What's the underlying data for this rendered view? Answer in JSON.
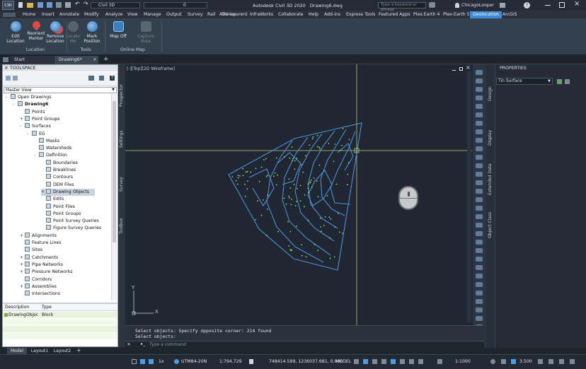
{
  "app": {
    "logo": "C3D",
    "workspace": "Civil 3D",
    "layer": "0",
    "title": "Autodesk Civil 3D 2020",
    "file": "Drawing6.dwg",
    "search_placeholder": "Type a keyword or phrase",
    "user": "ChicagoLooper"
  },
  "menu_tabs": [
    "Home",
    "Insert",
    "Annotate",
    "Modify",
    "Analyze",
    "View",
    "Manage",
    "Output",
    "Survey",
    "Rail",
    "Add-ins",
    "Transparent",
    "InfraWorks",
    "Collaborate",
    "Help",
    "Add-ins",
    "Express Tools",
    "Featured Apps",
    "Plex.Earth 4",
    "Plex-Earth 5",
    "Geolocation",
    "ArcGIS"
  ],
  "active_tab": "Geolocation",
  "ribbon": {
    "buttons": [
      {
        "label1": "Edit",
        "label2": "Location",
        "icon": "globe-edit-icon",
        "enabled": true
      },
      {
        "label1": "Reorient",
        "label2": "Marker",
        "icon": "marker-icon",
        "enabled": true
      },
      {
        "label1": "Remove",
        "label2": "Location",
        "icon": "globe-remove-icon",
        "enabled": true
      },
      {
        "label1": "Locate",
        "label2": "Me",
        "icon": "locate-me-icon",
        "enabled": false
      },
      {
        "label1": "Mark",
        "label2": "Position",
        "icon": "globe-mark-icon",
        "enabled": true
      },
      {
        "label1": "Map Off",
        "label2": "",
        "icon": "map-icon",
        "enabled": true
      },
      {
        "label1": "Capture",
        "label2": "Area",
        "icon": "capture-area-icon",
        "enabled": false
      }
    ],
    "panels": [
      "Location",
      "Tools",
      "Online Map"
    ]
  },
  "doc_tabs": [
    "Start",
    "Drawing6*"
  ],
  "toolspace": {
    "title": "TOOLSPACE",
    "view_select": "Master View",
    "tree": [
      {
        "label": "Open Drawings",
        "level": 0,
        "exp": "-"
      },
      {
        "label": "Drawing6",
        "level": 1,
        "exp": "-",
        "bold": true
      },
      {
        "label": "Points",
        "level": 2,
        "exp": ""
      },
      {
        "label": "Point Groups",
        "level": 2,
        "exp": "+"
      },
      {
        "label": "Surfaces",
        "level": 2,
        "exp": "-"
      },
      {
        "label": "EG",
        "level": 3,
        "exp": "-"
      },
      {
        "label": "Masks",
        "level": 4,
        "exp": ""
      },
      {
        "label": "Watersheds",
        "level": 4,
        "exp": ""
      },
      {
        "label": "Definition",
        "level": 4,
        "exp": "-"
      },
      {
        "label": "Boundaries",
        "level": 5,
        "exp": ""
      },
      {
        "label": "Breaklines",
        "level": 5,
        "exp": ""
      },
      {
        "label": "Contours",
        "level": 5,
        "exp": ""
      },
      {
        "label": "DEM Files",
        "level": 5,
        "exp": ""
      },
      {
        "label": "Drawing Objects",
        "level": 5,
        "exp": "+",
        "selected": true
      },
      {
        "label": "Edits",
        "level": 5,
        "exp": ""
      },
      {
        "label": "Point Files",
        "level": 5,
        "exp": ""
      },
      {
        "label": "Point Groups",
        "level": 5,
        "exp": ""
      },
      {
        "label": "Point Survey Queries",
        "level": 5,
        "exp": ""
      },
      {
        "label": "Figure Survey Queries",
        "level": 5,
        "exp": ""
      },
      {
        "label": "Alignments",
        "level": 2,
        "exp": "+"
      },
      {
        "label": "Feature Lines",
        "level": 2,
        "exp": ""
      },
      {
        "label": "Sites",
        "level": 2,
        "exp": ""
      },
      {
        "label": "Catchments",
        "level": 2,
        "exp": "+"
      },
      {
        "label": "Pipe Networks",
        "level": 2,
        "exp": "+"
      },
      {
        "label": "Pressure Networks",
        "level": 2,
        "exp": "+"
      },
      {
        "label": "Corridors",
        "level": 2,
        "exp": ""
      },
      {
        "label": "Assemblies",
        "level": 2,
        "exp": "+"
      },
      {
        "label": "Intersections",
        "level": 2,
        "exp": ""
      }
    ],
    "grid_headers": [
      "Description",
      "Type"
    ],
    "grid_rows": [
      [
        "DrawingObjec",
        "Block"
      ]
    ]
  },
  "side_tabs": [
    "Prospector",
    "Settings",
    "Survey",
    "Toolbox"
  ],
  "viewport": {
    "label": "[-][Top][2D Wireframe]",
    "axis_y": "Y",
    "axis_x": "X"
  },
  "command": {
    "history1": "Select objects: Specify opposite corner: 214 found",
    "history2": "Select objects:",
    "prompt": "Type a command"
  },
  "properties": {
    "title": "PROPERTIES",
    "selection": "Tin Surface"
  },
  "palette_tabs": [
    "Design",
    "Display",
    "Extended Data",
    "Object Class"
  ],
  "layout_tabs": [
    "Model",
    "Layout1",
    "Layout2"
  ],
  "status": {
    "coordsys": "UTM84-20N",
    "scale": "1:794.729",
    "coords": "748414.599, 1236037.681, 0.000",
    "space": "MODEL",
    "annoscale": "1:1000",
    "elevation": "3.500"
  }
}
